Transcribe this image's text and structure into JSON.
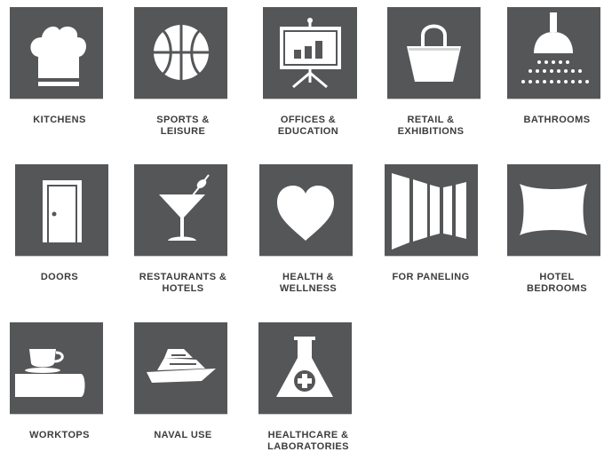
{
  "categories": [
    {
      "label": "KITCHENS",
      "icon": "chef-hat-icon"
    },
    {
      "label": "SPORTS &\nLEISURE",
      "icon": "basketball-icon"
    },
    {
      "label": "OFFICES &\nEDUCATION",
      "icon": "presentation-board-icon"
    },
    {
      "label": "RETAIL &\nEXHIBITIONS",
      "icon": "shopping-bag-icon"
    },
    {
      "label": "BATHROOMS",
      "icon": "shower-icon"
    },
    {
      "label": "DOORS",
      "icon": "door-icon"
    },
    {
      "label": "RESTAURANTS &\nHOTELS",
      "icon": "cocktail-glass-icon"
    },
    {
      "label": "HEALTH &\nWELLNESS",
      "icon": "heart-icon"
    },
    {
      "label": "FOR PANELING",
      "icon": "wall-panels-icon"
    },
    {
      "label": "HOTEL\nBEDROOMS",
      "icon": "pillow-icon"
    },
    {
      "label": "WORKTOPS",
      "icon": "coffee-cup-countertop-icon"
    },
    {
      "label": "NAVAL USE",
      "icon": "yacht-icon"
    },
    {
      "label": "HEALTHCARE &\nLABORATORIES",
      "icon": "lab-flask-icon"
    }
  ],
  "colors": {
    "tile_background": "#555658",
    "icon": "#ffffff",
    "label_text": "#3c3c3c"
  }
}
